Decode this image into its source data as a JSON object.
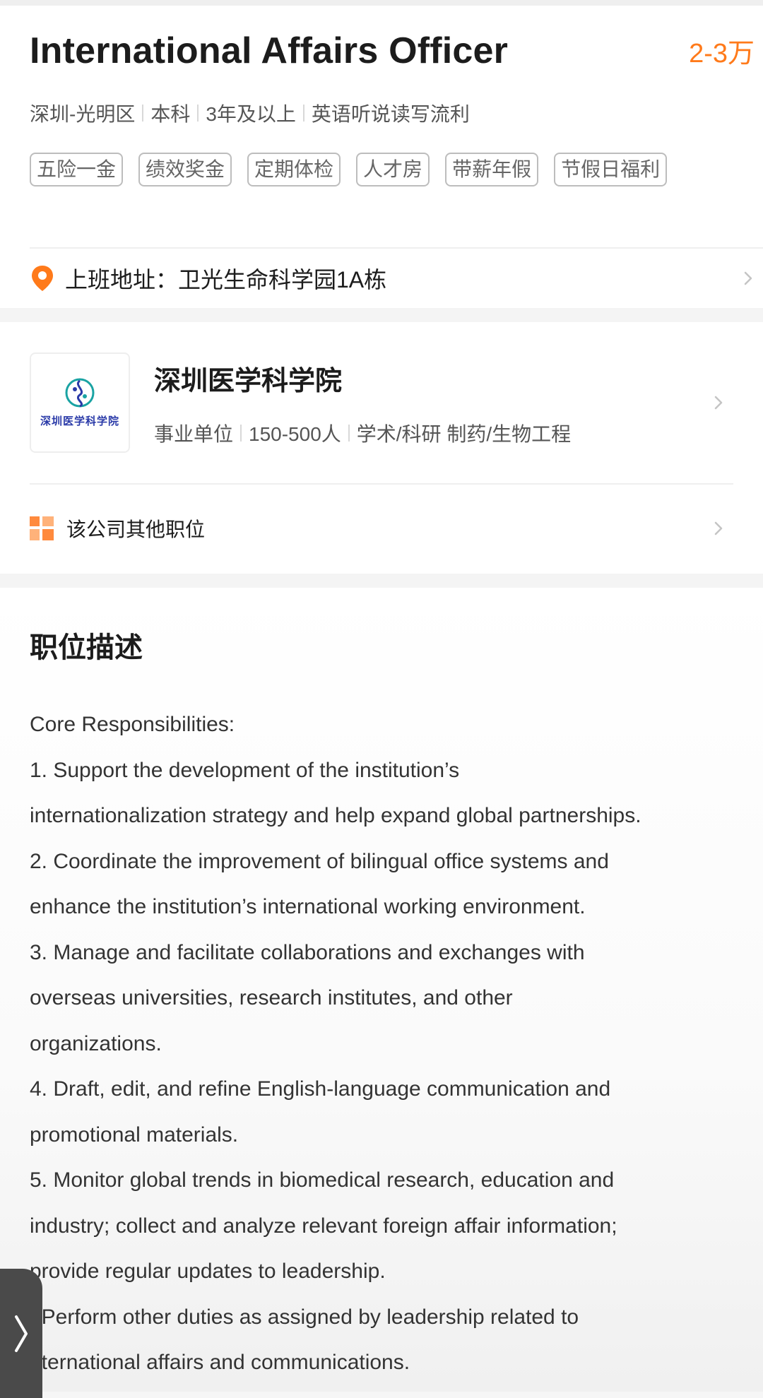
{
  "job": {
    "title": "International Affairs Officer",
    "salary": "2-3万",
    "meta": [
      "深圳-光明区",
      "本科",
      "3年及以上",
      "英语听说读写流利"
    ],
    "tags": [
      "五险一金",
      "绩效奖金",
      "定期体检",
      "人才房",
      "带薪年假",
      "节假日福利"
    ],
    "address_label": "上班地址：卫光生命科学园1A栋"
  },
  "company": {
    "name": "深圳医学科学院",
    "logo_text": "深圳医学科学院",
    "meta": [
      "事业单位",
      "150-500人",
      "学术/科研 制药/生物工程"
    ],
    "other_jobs_label": "该公司其他职位"
  },
  "description": {
    "title": "职位描述",
    "lines": [
      "Core Responsibilities:",
      "1. Support the development of the institution’s",
      "internationalization strategy and help expand global partnerships.",
      "2. Coordinate the improvement of bilingual office systems and",
      "enhance the institution’s international working environment.",
      "3. Manage and facilitate collaborations and exchanges with",
      "overseas universities, research institutes, and other",
      "organizations.",
      "4. Draft, edit, and refine English-language communication and",
      "promotional materials.",
      "5. Monitor global trends in biomedical research, education and",
      "industry; collect and analyze relevant foreign affair information;",
      "provide regular updates to leadership.",
      ". Perform other duties as assigned by leadership related to",
      "nternational affairs and communications."
    ]
  },
  "colors": {
    "accent": "#ff7a1a",
    "logo_blue": "#2a3aa8",
    "logo_teal": "#1aa3a3"
  },
  "icons": {
    "location": "location-pin-icon",
    "other_jobs": "grid-icon",
    "chevron": "chevron-right-icon",
    "side": "expand-handle-icon"
  }
}
